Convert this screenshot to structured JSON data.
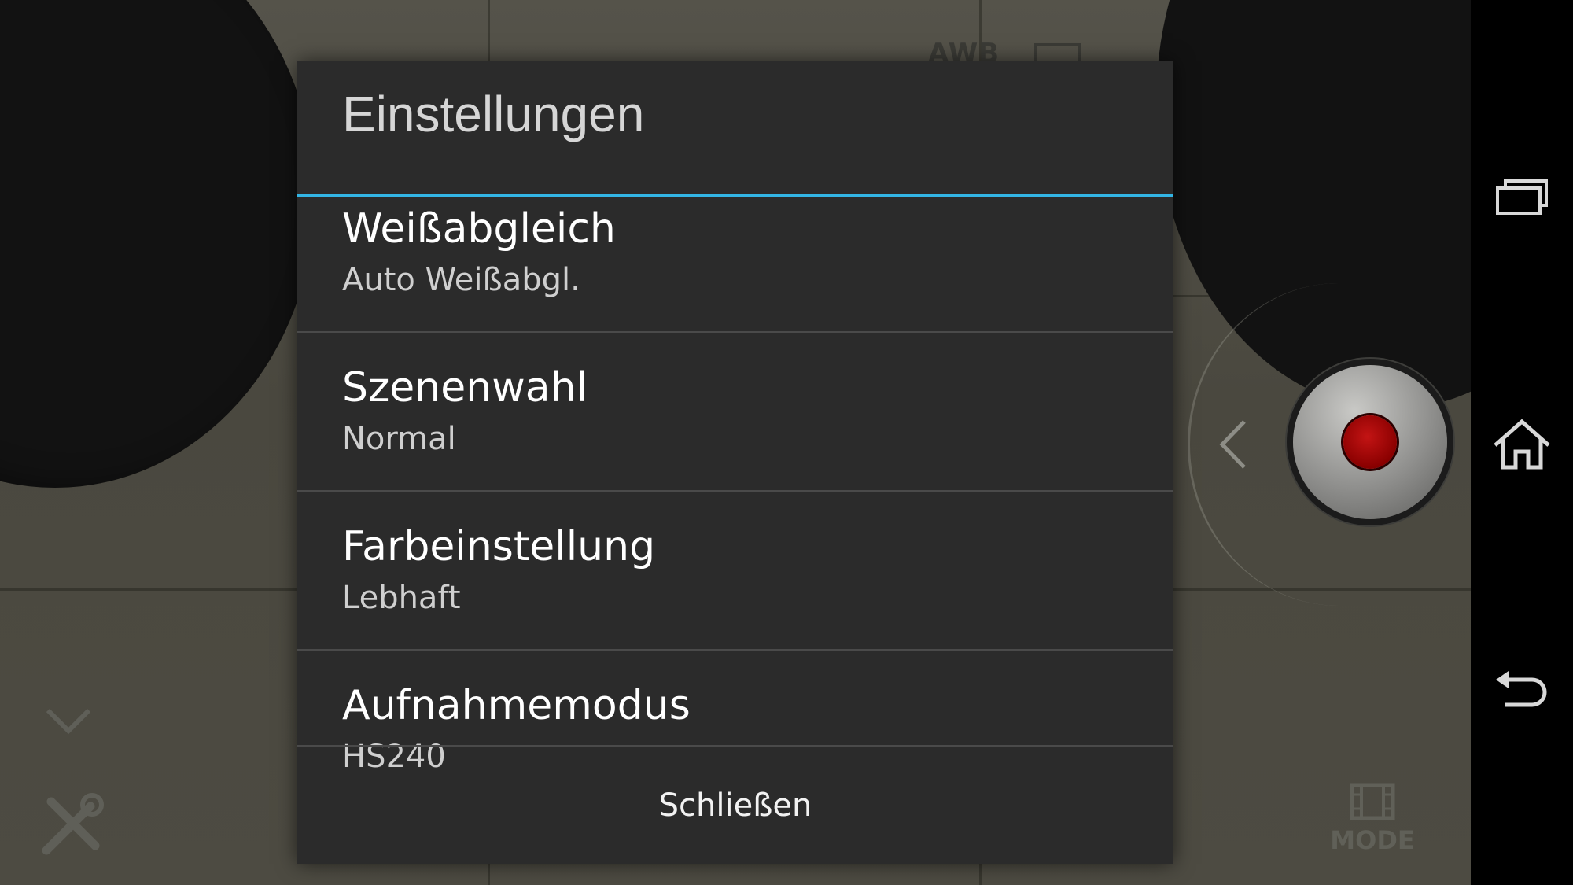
{
  "viewfinder": {
    "awb_label": "AWB"
  },
  "camera": {
    "mode_label": "MODE",
    "shutter_color": "#8a0000"
  },
  "dialog": {
    "title": "Einstellungen",
    "accent_color": "#33b5e5",
    "items": [
      {
        "title": "Weißabgleich",
        "summary": "Auto Weißabgl."
      },
      {
        "title": "Szenenwahl",
        "summary": "Normal"
      },
      {
        "title": "Farbeinstellung",
        "summary": "Lebhaft"
      },
      {
        "title": "Aufnahmemodus",
        "summary": "HS240"
      }
    ],
    "close_label": "Schließen"
  },
  "nav_bar": {
    "icons": [
      "recent-apps-icon",
      "home-icon",
      "back-icon"
    ]
  }
}
